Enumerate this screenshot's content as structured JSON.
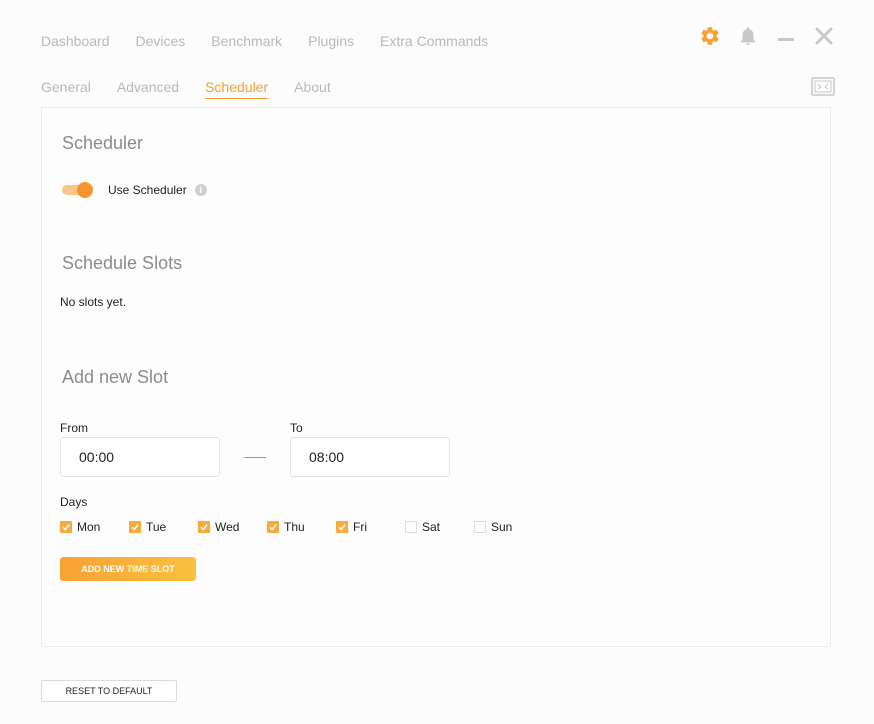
{
  "topnav": {
    "items": [
      {
        "label": "Dashboard"
      },
      {
        "label": "Devices"
      },
      {
        "label": "Benchmark"
      },
      {
        "label": "Plugins"
      },
      {
        "label": "Extra Commands"
      }
    ]
  },
  "subnav": {
    "tabs": [
      {
        "label": "General"
      },
      {
        "label": "Advanced"
      },
      {
        "label": "Scheduler",
        "active": true
      },
      {
        "label": "About"
      }
    ]
  },
  "icons": {
    "settings": "gear-icon",
    "notifications": "bell-icon",
    "minimize": "minimize-icon",
    "close": "close-icon",
    "expand": "expand-icon",
    "info": "info-icon"
  },
  "colors": {
    "accent": "#f7a132",
    "toggle_track": "#f8c58a",
    "toggle_knob": "#f7962c",
    "muted_text": "#b9b9b9"
  },
  "scheduler": {
    "title": "Scheduler",
    "use_scheduler_label": "Use Scheduler",
    "use_scheduler_enabled": true,
    "info_glyph": "i"
  },
  "slots": {
    "title": "Schedule Slots",
    "empty_text": "No slots yet."
  },
  "new_slot": {
    "title": "Add new Slot",
    "from_label": "From",
    "from_value": "00:00",
    "to_label": "To",
    "to_value": "08:00",
    "days_label": "Days",
    "days": [
      {
        "label": "Mon",
        "checked": true
      },
      {
        "label": "Tue",
        "checked": true
      },
      {
        "label": "Wed",
        "checked": true
      },
      {
        "label": "Thu",
        "checked": true
      },
      {
        "label": "Fri",
        "checked": true
      },
      {
        "label": "Sat",
        "checked": false
      },
      {
        "label": "Sun",
        "checked": false
      }
    ],
    "add_button_label": "ADD NEW TIME SLOT"
  },
  "footer": {
    "reset_button_label": "RESET TO DEFAULT"
  }
}
